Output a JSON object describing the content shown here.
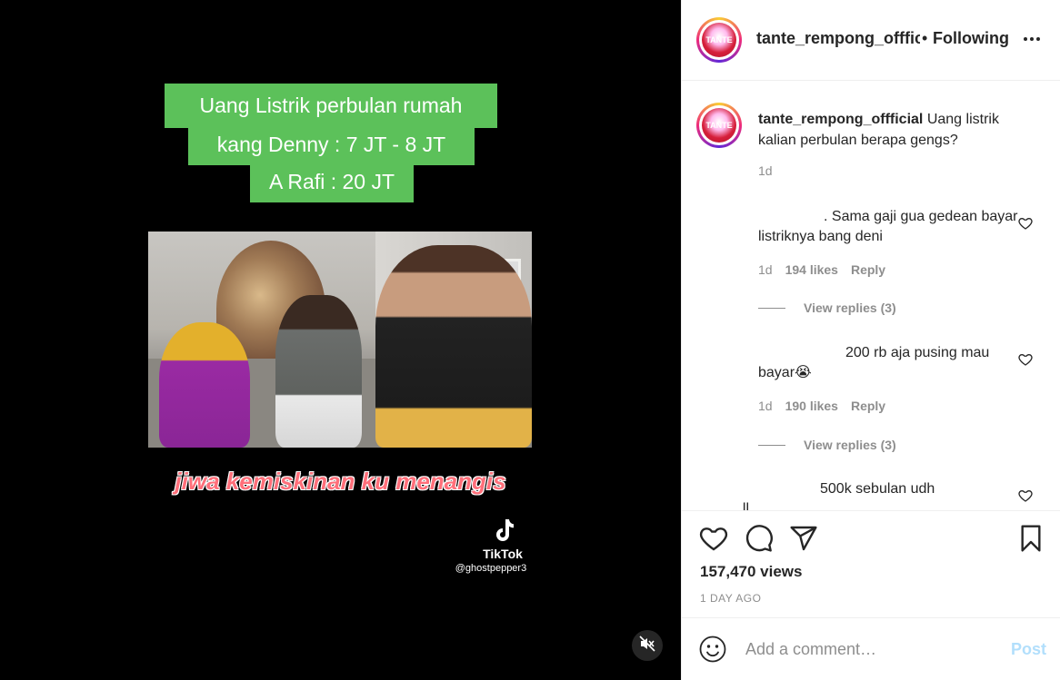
{
  "video": {
    "caption_line1": "Uang Listrik perbulan rumah",
    "caption_line2": "kang Denny : 7 JT - 8 JT",
    "caption_line3": "A Rafi : 20 JT",
    "subtitle": "jiwa kemiskinan ku menangis",
    "watermark_name": "TikTok",
    "watermark_user": "@ghostpepper3",
    "caption_color": "#5cc15a"
  },
  "header": {
    "username": "tante_rempong_offficial",
    "separator": "•",
    "follow_status": "Following",
    "more": "•••"
  },
  "post": {
    "username": "tante_rempong_offficial",
    "caption": "Uang listrik kalian perbulan berapa gengs?",
    "time": "1d"
  },
  "comments": [
    {
      "text": ". Sama gaji gua gedean bayar listriknya bang deni",
      "time": "1d",
      "likes": "194 likes",
      "reply": "Reply",
      "view_replies": "View replies (3)"
    },
    {
      "text": "200 rb aja pusing mau bayar😭",
      "time": "1d",
      "likes": "190 likes",
      "reply": "Reply",
      "view_replies": "View replies (3)"
    },
    {
      "text": "500k sebulan udh",
      "partial": "... ... ...ll ..."
    }
  ],
  "stats": {
    "views": "157,470 views",
    "posted": "1 DAY AGO"
  },
  "add_comment": {
    "placeholder": "Add a comment…",
    "post_label": "Post"
  }
}
